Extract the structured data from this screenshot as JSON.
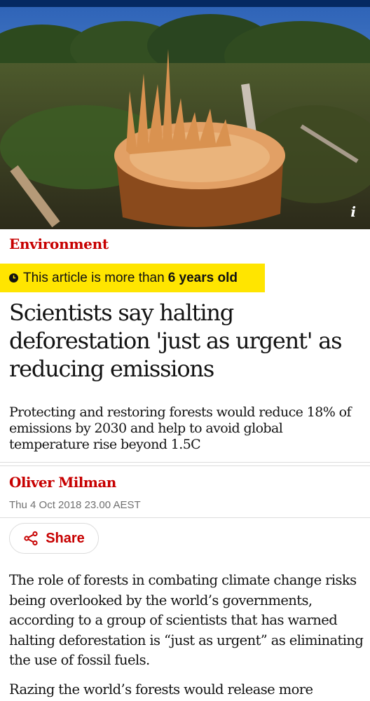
{
  "header": {
    "brand_color": "#052962"
  },
  "hero": {
    "description_icon": "info-icon",
    "info_glyph": "i"
  },
  "article": {
    "section": "Environment",
    "age_notice": {
      "prefix": "This article is more than",
      "age": "6 years old",
      "icon": "clock-icon",
      "background": "#ffe500"
    },
    "headline": "Scientists say halting deforestation 'just as urgent' as reducing emissions",
    "standfirst": "Protecting and restoring forests would reduce 18% of emissions by 2030 and help to avoid global temperature rise beyond 1.5C",
    "author": "Oliver Milman",
    "date": "Thu 4 Oct 2018 23.00 AEST",
    "share_label": "Share",
    "paragraphs": [
      "The role of forests in combating climate change risks being overlooked by the world’s governments, according to a group of scientists that has warned halting deforestation is “just as urgent” as eliminating the use of fossil fuels.",
      "Razing the world’s forests would release more"
    ]
  },
  "colors": {
    "accent": "#c70000",
    "text": "#121212",
    "muted": "#707070"
  }
}
